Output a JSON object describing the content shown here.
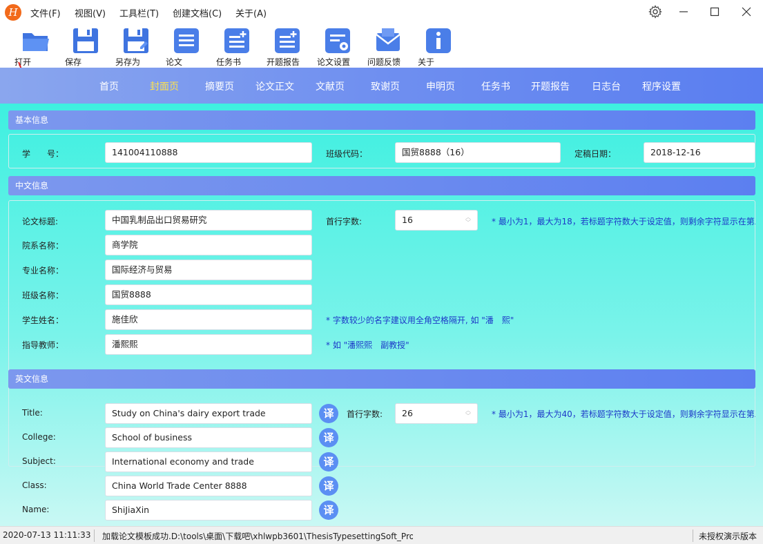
{
  "app": {
    "logo_letter": "H"
  },
  "menu": [
    "文件(F)",
    "视图(V)",
    "工具栏(T)",
    "创建文档(C)",
    "关于(A)"
  ],
  "toolbar": {
    "open": "打开",
    "save": "保存",
    "save_as": "另存为",
    "thesis": "论文",
    "task_book": "任务书",
    "proposal": "开题报告",
    "thesis_settings": "论文设置",
    "feedback": "问题反馈",
    "about": "关于"
  },
  "nav": [
    "首页",
    "封面页",
    "摘要页",
    "论文正文",
    "文献页",
    "致谢页",
    "申明页",
    "任务书",
    "开题报告",
    "日志台",
    "程序设置"
  ],
  "nav_active_index": 1,
  "basic": {
    "header": "基本信息",
    "student_id_label": "学　　号：",
    "student_id": "141004110888",
    "class_code_label": "班级代码：",
    "class_code": "国贸8888（16）",
    "date_label": "定稿日期：",
    "date": "2018-12-16"
  },
  "chinese": {
    "header": "中文信息",
    "title_label": "论文标题:",
    "title": "中国乳制品出口贸易研究",
    "first_line_label": "首行字数:",
    "first_line": "16",
    "first_line_hint": "* 最小为1，最大为18，若标题字符数大于设定值，则剩余字符显示在第二",
    "dept_label": "院系名称：",
    "dept": "商学院",
    "major_label": "专业名称：",
    "major": "国际经济与贸易",
    "class_label": "班级名称：",
    "class": "国贸8888",
    "student_label": "学生姓名：",
    "student": "施佳欣",
    "student_hint": "* 字数较少的名字建议用全角空格隔开, 如 \"潘　熙\"",
    "advisor_label": "指导教师：",
    "advisor": "潘熙熙",
    "advisor_hint": "* 如 \"潘熙熙　副教授\""
  },
  "english": {
    "header": "英文信息",
    "title_label": "Title:",
    "title": "Study on China's dairy export trade",
    "first_line_label": "首行字数:",
    "first_line": "26",
    "first_line_hint": "* 最小为1，最大为40，若标题字符数大于设定值，则剩余字符显示在第二",
    "college_label": "College:",
    "college": "School of business",
    "subject_label": "Subject:",
    "subject": "International economy and trade",
    "class_label": "Class:",
    "class": "China World Trade Center 8888",
    "name_label": "Name:",
    "name": "ShiJiaXin",
    "translate_btn": "译"
  },
  "status": {
    "datetime": "2020-07-13 11:11:33",
    "message": "加载论文模板成功.D:\\tools\\桌面\\下载吧\\xhlwpb3601\\ThesisTypesettingSoft_Pro'",
    "license": "未授权演示版本"
  },
  "colors": {
    "accent": "#5c7ff0",
    "nav_active": "#ffe24d",
    "hint": "#1c38c8",
    "main_bg": "#3ef0e0"
  }
}
